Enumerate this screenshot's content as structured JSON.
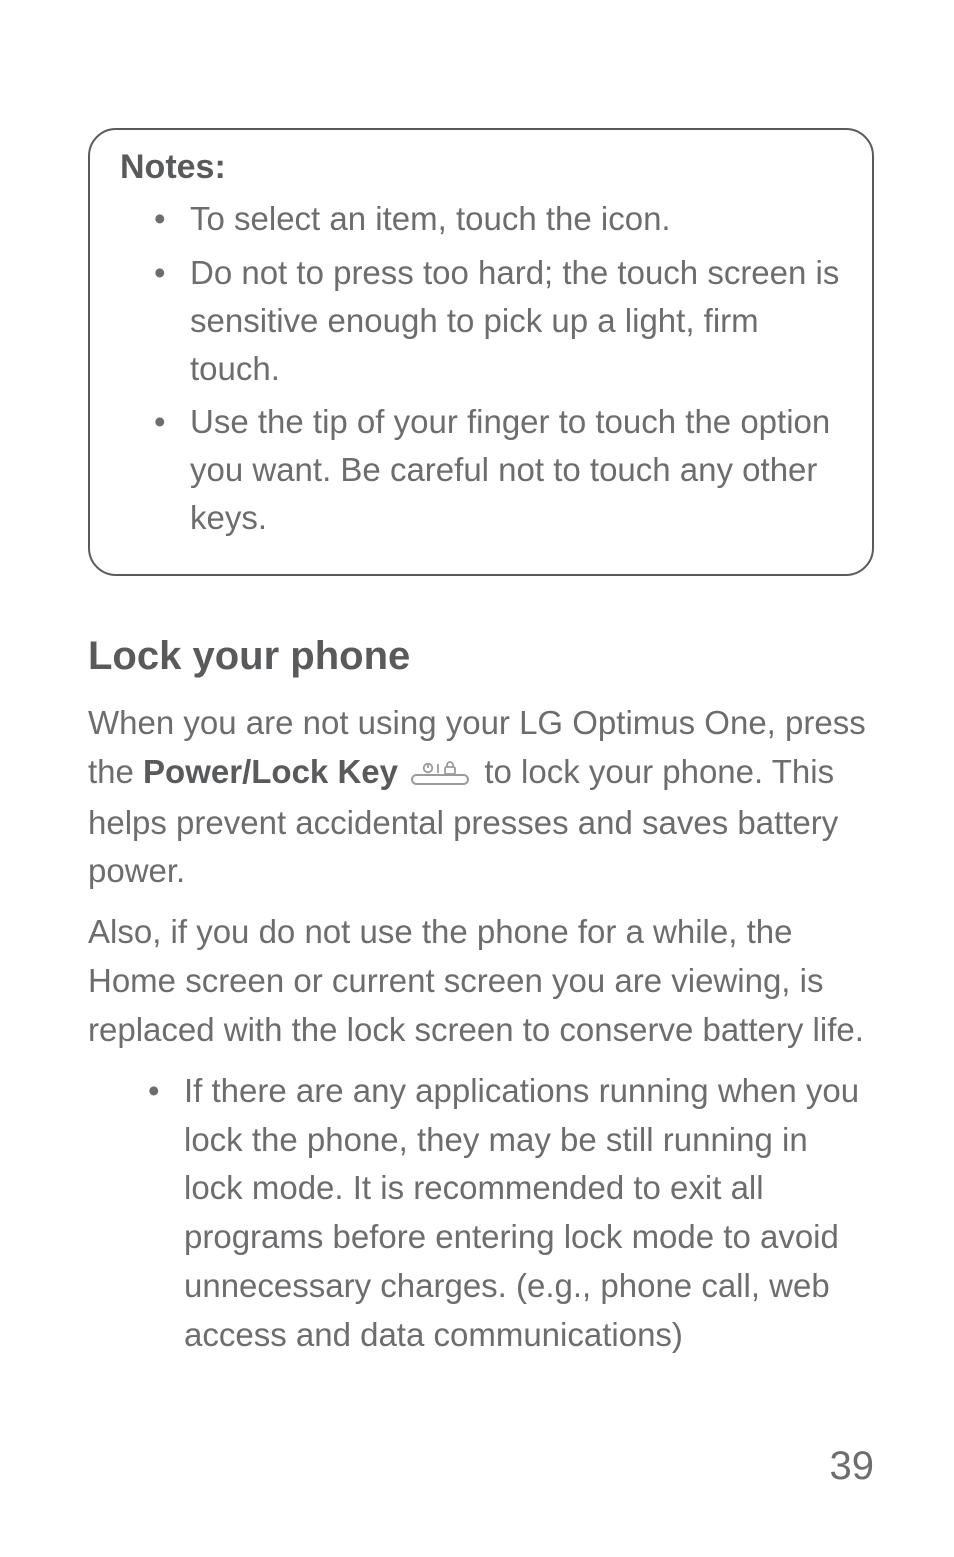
{
  "notes": {
    "title": "Notes:",
    "items": [
      "To select an item, touch the icon.",
      "Do not to press too hard; the touch screen is sensitive enough to pick up a light, firm touch.",
      "Use the tip of your finger to touch the option you want. Be careful not to touch any other keys."
    ]
  },
  "section": {
    "heading": "Lock your phone",
    "para1_pre": "When you are not using your LG Optimus One, press the ",
    "key_label": "Power/Lock Key",
    "para1_post": " to lock your phone. This helps prevent accidental presses and saves battery power.",
    "para2": "Also, if you do not use the phone for a while, the Home screen or current screen you are viewing, is replaced with the lock screen to conserve battery life.",
    "bullets": [
      "If there are any applications running when you lock the phone, they may be still running in lock mode. It is recommended to exit all programs before entering lock mode to avoid unnecessary charges. (e.g., phone call, web access and data communications)"
    ]
  },
  "page_number": "39",
  "icons": {
    "power_lock": "power-lock-key-icon"
  }
}
